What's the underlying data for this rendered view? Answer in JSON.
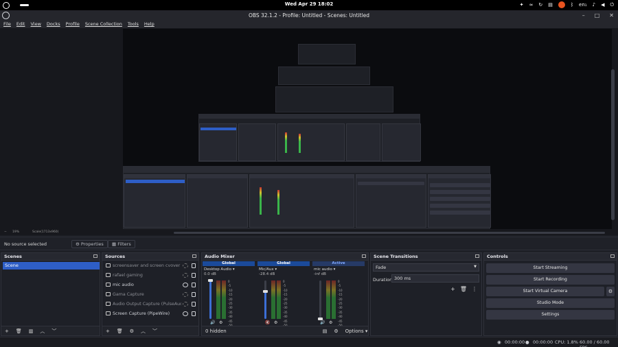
{
  "topbar": {
    "clock": "Wed Apr 29  18:02",
    "lang": "en₁"
  },
  "window": {
    "title": "OBS 32.1.2 - Profile: Untitled - Scenes: Untitled"
  },
  "menu": [
    "File",
    "Edit",
    "View",
    "Docks",
    "Profile",
    "Scene Collection",
    "Tools",
    "Help"
  ],
  "zoom": {
    "level": "19%",
    "scale": "Scale(1713x960)"
  },
  "toolbar": {
    "no_source": "No source selected",
    "properties": "Properties",
    "filters": "Filters"
  },
  "scenes": {
    "title": "Scenes",
    "items": [
      "Scene"
    ]
  },
  "sources": {
    "title": "Sources",
    "items": [
      {
        "label": "screensaver and screen cvover for l",
        "icon": "screen-icon",
        "visible": false
      },
      {
        "label": "rafael gaming",
        "icon": "image-icon",
        "visible": false
      },
      {
        "label": "mic audio",
        "icon": "mic-icon",
        "visible": true
      },
      {
        "label": "Gama Capture",
        "icon": "gamepad-icon",
        "visible": false
      },
      {
        "label": "Audio Output Capture (PulseAudio)",
        "icon": "speaker-icon",
        "visible": false
      },
      {
        "label": "Screen Capture (PipeWire)",
        "icon": "monitor-icon",
        "visible": true
      }
    ]
  },
  "mixer": {
    "title": "Audio Mixer",
    "channels": [
      {
        "header": "Global",
        "name": "Desktop Audio",
        "db": "0.0 dB",
        "volume": 1.0,
        "muted": false
      },
      {
        "header": "Global",
        "name": "Mic/Aux",
        "db": "-28.4 dB",
        "volume": 0.72,
        "muted": true
      },
      {
        "header": "Active",
        "name": "mic audio",
        "db": "-inf dB",
        "volume": 0.0,
        "muted": false
      }
    ],
    "scale": [
      "0",
      "-5",
      "-10",
      "-15",
      "-20",
      "-25",
      "-30",
      "-35",
      "-40",
      "-45",
      "-50",
      "-55",
      "-60"
    ],
    "hidden": "0 hidden",
    "options": "Options"
  },
  "transitions": {
    "title": "Scene Transitions",
    "selected": "Fade",
    "duration_label": "Duration",
    "duration": "300 ms"
  },
  "controls": {
    "title": "Controls",
    "buttons": [
      "Start Streaming",
      "Start Recording",
      "Start Virtual Camera",
      "Studio Mode",
      "Settings"
    ]
  },
  "status": {
    "stream_time": "00:00:00",
    "rec_time": "00:00:00",
    "cpu": "CPU: 1.8%",
    "fps": "60.00 / 60.00 FPS"
  },
  "colors": {
    "accent": "#2e5ec6",
    "background": "#1d1f26",
    "panel": "#1e2027",
    "mute_red": "#d34747"
  }
}
